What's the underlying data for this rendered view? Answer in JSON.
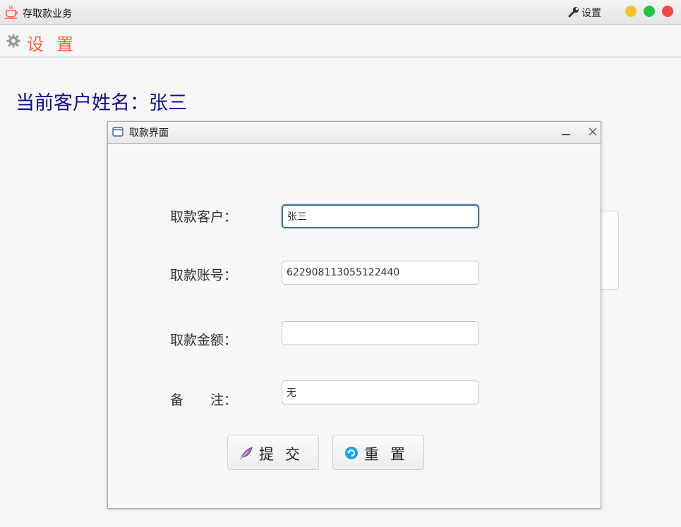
{
  "window": {
    "title": "存取款业务",
    "settings_label": "设置",
    "traffic_lights": {
      "minimize": "#f6c12e",
      "maximize": "#21c34a",
      "close": "#f04848"
    }
  },
  "menu": {
    "settings_label": "设置",
    "accent_color": "#f0623c"
  },
  "customer_banner": "当前客户姓名：张三",
  "dialog": {
    "title": "取款界面",
    "fields": {
      "customer": {
        "label": "取款客户：",
        "value": "张三"
      },
      "account": {
        "label": "取款账号：",
        "value": "622908113055122440"
      },
      "amount": {
        "label": "取款金额：",
        "value": ""
      },
      "remark": {
        "label": "备　　注：",
        "value": "无"
      }
    },
    "buttons": {
      "submit": "提交",
      "reset": "重置"
    }
  }
}
